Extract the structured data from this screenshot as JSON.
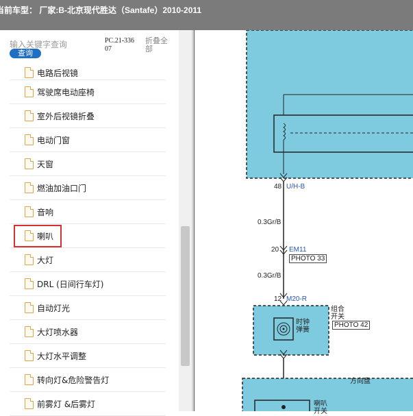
{
  "header": {
    "title": "当前车型： 厂家:B-北京现代胜达（Santafe）2010-2011"
  },
  "search": {
    "placeholder": "输入关键字查询",
    "button": "查询"
  },
  "pc_code": "PC.21-33607",
  "collapse_all": "折叠全部",
  "tree": {
    "items": [
      {
        "label": "电路后视镜"
      },
      {
        "label": "驾驶席电动座椅"
      },
      {
        "label": "室外后视镜折叠"
      },
      {
        "label": "电动门窗"
      },
      {
        "label": "天窗"
      },
      {
        "label": "燃油加油口门"
      },
      {
        "label": "音响"
      },
      {
        "label": "喇叭"
      },
      {
        "label": "大灯"
      },
      {
        "label": "DRL (日间行车灯)"
      },
      {
        "label": "自动灯光"
      },
      {
        "label": "大灯喷水器"
      },
      {
        "label": "大灯水平调整"
      },
      {
        "label": "转向灯&危险警告灯"
      },
      {
        "label": "前雾灯 &后雾灯"
      }
    ],
    "selected_index": 7
  },
  "diagram": {
    "pin_48": "48",
    "conn_uhb": "U/H-B",
    "wire_1": "0.3Gr/B",
    "pin_20": "20",
    "conn_em11": "EM11",
    "photo_33": "PHOTO 33",
    "wire_2": "0.3Gr/B",
    "pin_12": "12",
    "conn_m20r": "M20-R",
    "combo_switch": "组合\n开关",
    "clock_spring": "时钟\n弹簧",
    "photo_42": "PHOTO 42",
    "steering_wheel": "方向盘",
    "horn_switch": "喇叭\n开关"
  },
  "colors": {
    "accent": "#1f6fc4",
    "diagram_fill": "#7ecbe0",
    "highlight": "#d8302f",
    "wire_label": "#2455b8"
  }
}
